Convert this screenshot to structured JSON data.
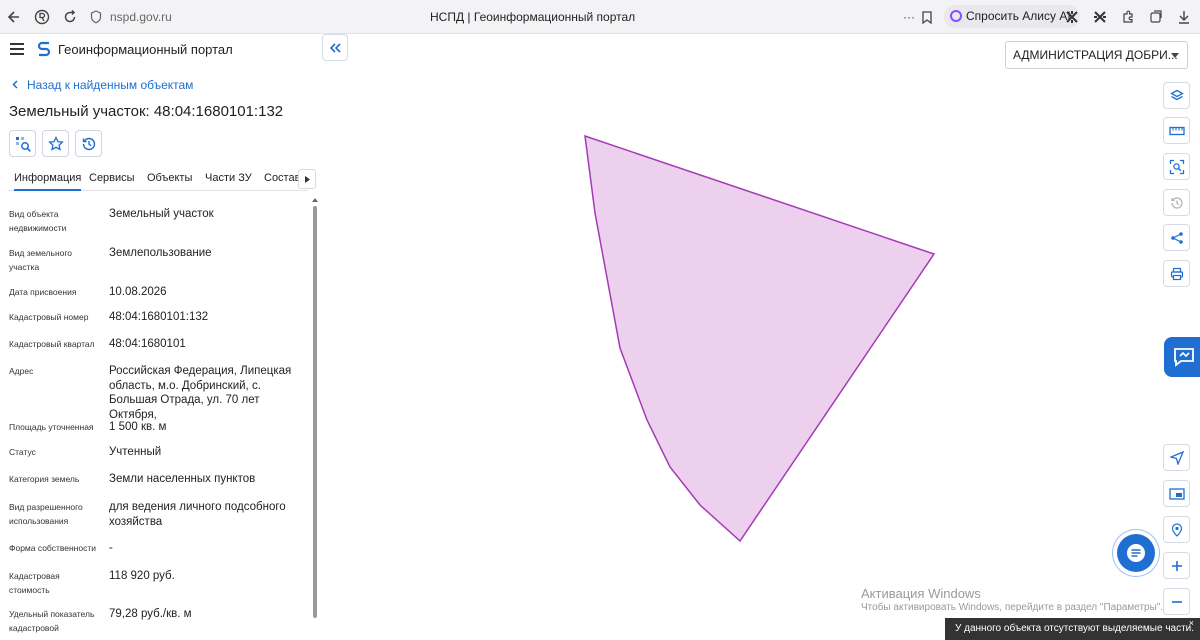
{
  "browser": {
    "url": "nspd.gov.ru",
    "tab_title": "НСПД | Геоинформационный портал",
    "alisa_label": "Спросить Алису AI",
    "menu_dots": "···"
  },
  "app": {
    "title": "Геоинформационный портал"
  },
  "header": {
    "admin_select": "АДМИНИСТРАЦИЯ ДОБРИ..."
  },
  "panel": {
    "back_link": "Назад к найденным объектам",
    "object_title": "Земельный участок: 48:04:1680101:132",
    "tabs": [
      "Информация",
      "Сервисы",
      "Объекты",
      "Части ЗУ",
      "Состав"
    ],
    "properties": [
      {
        "label": "Вид объекта недвижимости",
        "value": "Земельный участок"
      },
      {
        "label": "Вид земельного участка",
        "value": "Землепользование"
      },
      {
        "label": "Дата присвоения",
        "value": "10.08.2026"
      },
      {
        "label": "Кадастровый номер",
        "value": "48:04:1680101:132"
      },
      {
        "label": "Кадастровый квартал",
        "value": "48:04:1680101"
      },
      {
        "label": "Адрес",
        "value": "Российская Федерация, Липецкая область, м.о. Добринский, с. Большая Отрада, ул. 70 лет Октября,"
      },
      {
        "label": "Площадь уточненная",
        "value": "1 500 кв. м"
      },
      {
        "label": "Статус",
        "value": "Учтенный"
      },
      {
        "label": "Категория земель",
        "value": "Земли населенных пунктов"
      },
      {
        "label": "Вид разрешенного использования",
        "value": "для ведения личного подсобного хозяйства"
      },
      {
        "label": "Форма собственности",
        "value": "-"
      },
      {
        "label": "Кадастровая стоимость",
        "value": "118 920 руб."
      },
      {
        "label": "Удельный показатель кадастровой",
        "value": "79,28 руб./кв. м"
      }
    ]
  },
  "map": {
    "parcel_fill": "#ecd0ee",
    "parcel_stroke": "#a43bb4"
  },
  "watermark": {
    "title": "Активация Windows",
    "subtitle": "Чтобы активировать Windows, перейдите в раздел \"Параметры\"."
  },
  "toast": {
    "message": "У данного объекта отсутствуют выделяемые части.",
    "close": "×"
  },
  "colors": {
    "accent": "#1e6fd1"
  }
}
